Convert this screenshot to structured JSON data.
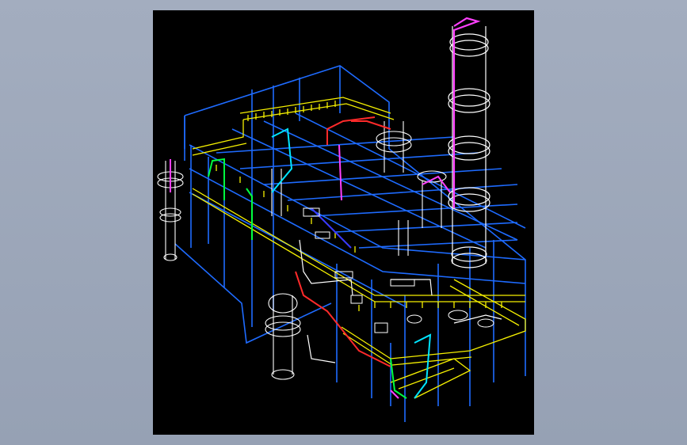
{
  "viewport": {
    "background": "#000000",
    "content": "3d-plant-piping-model"
  },
  "colors": {
    "steel_frame": "#1e6bff",
    "walkway_grating": "#f5f000",
    "vessel": "#ffffff",
    "pipe_hot": "#ff2a2a",
    "pipe_utility": "#00ff40",
    "pipe_special": "#ff40ff",
    "pipe_cyan": "#00e5ff",
    "page_background": "#9aa5b8"
  },
  "icons": {
    "stack": "tall-column-icon",
    "vessel": "drum-icon"
  }
}
